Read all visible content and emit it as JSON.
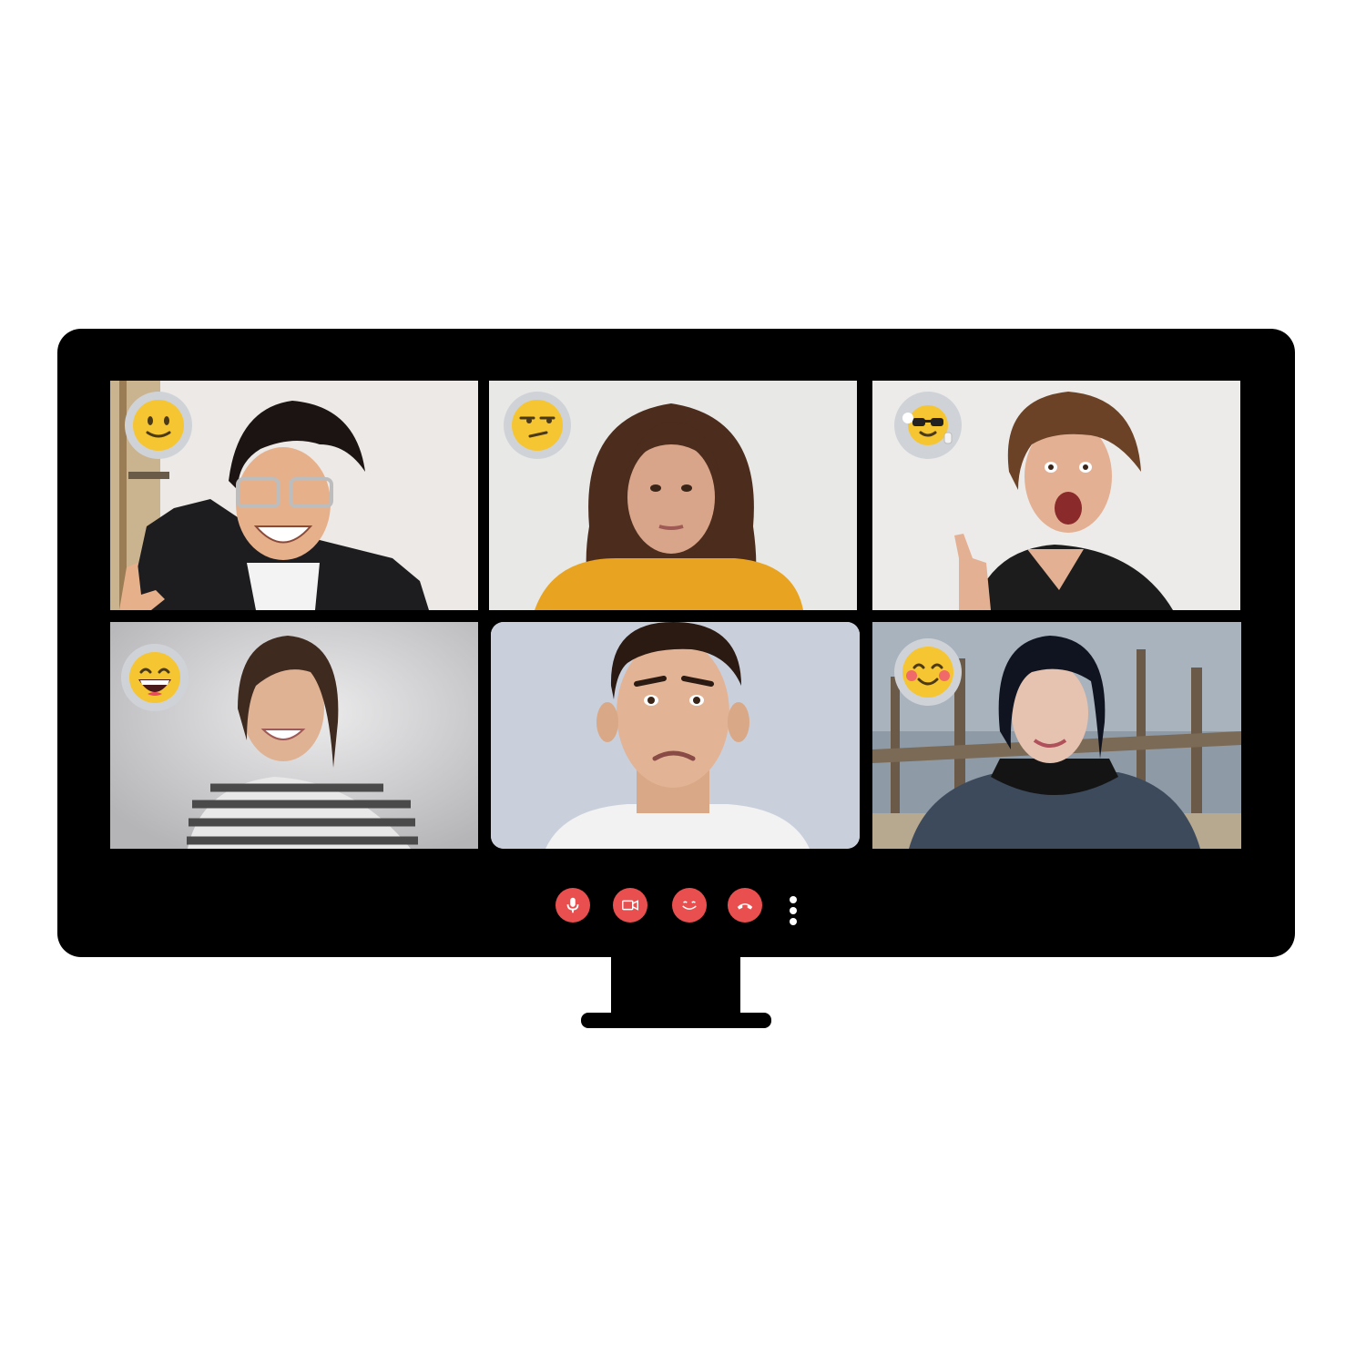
{
  "app": {
    "name": ""
  },
  "participants": [
    {
      "reaction_icon": "slightly-smiling-face-icon",
      "bg": "#ece9e6"
    },
    {
      "reaction_icon": "unamused-face-icon",
      "bg": "#e8e8e6"
    },
    {
      "reaction_icon": "cool-face-thumbs-up-icon",
      "bg": "#ecebe9"
    },
    {
      "reaction_icon": "grinning-face-icon",
      "bg": "#d7d7d9"
    },
    {
      "reaction_icon": "",
      "bg": "#c9d0dc"
    },
    {
      "reaction_icon": "blushing-face-icon",
      "bg": "#8e9aa6"
    }
  ],
  "controls": [
    {
      "name": "microphone",
      "icon": "microphone-icon"
    },
    {
      "name": "camera",
      "icon": "video-camera-icon"
    },
    {
      "name": "reactions",
      "icon": "smile-icon"
    },
    {
      "name": "end-call",
      "icon": "hang-up-icon"
    },
    {
      "name": "more",
      "icon": "more-vertical-icon"
    }
  ],
  "colors": {
    "monitor": "#000000",
    "control_bg": "#ea4f4f",
    "badge_bg": "#cfd3d8",
    "emoji": "#f6c532"
  }
}
